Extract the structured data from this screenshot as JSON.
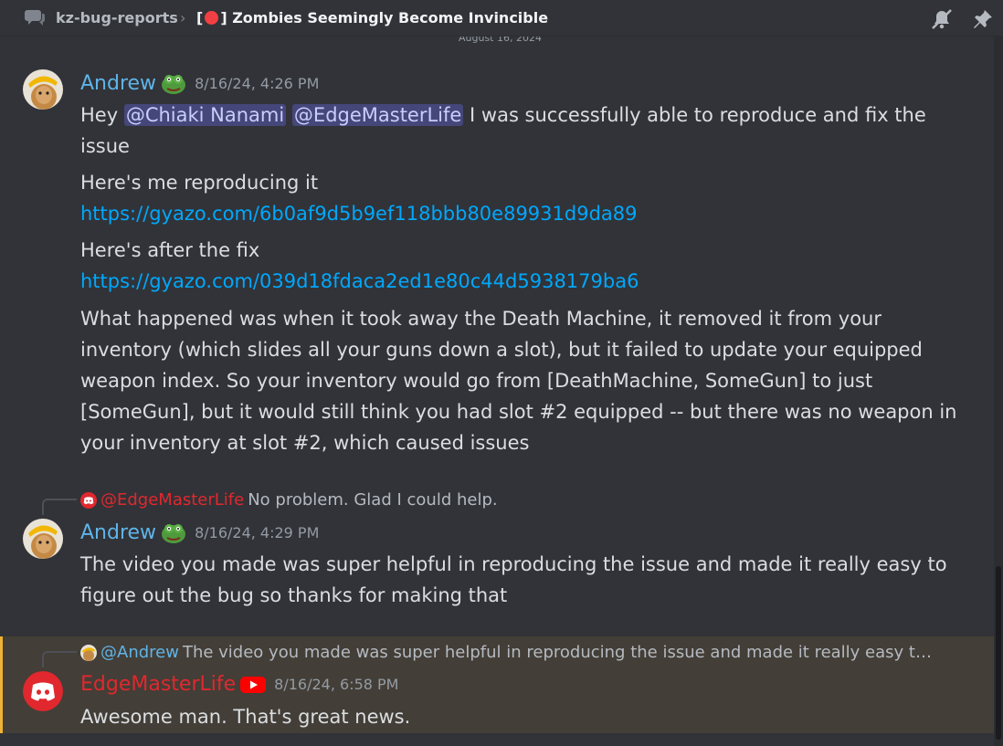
{
  "header": {
    "channel": "kz-bug-reports",
    "separator": "›",
    "thread_prefix": "[",
    "thread_suffix": "] Zombies Seemingly Become Invincible"
  },
  "date_divider": "August 16, 2024",
  "messages": [
    {
      "author": "Andrew",
      "timestamp": "8/16/24, 4:26 PM",
      "greeting": "Hey",
      "mention1": "@Chiaki Nanami",
      "mention2": "@EdgeMasterLife",
      "line1_rest": "I was successfully able to reproduce and fix the issue",
      "line2": "Here's me reproducing it",
      "link1": "https://gyazo.com/6b0af9d5b9ef118bbb80e89931d9da89",
      "line3": "Here's after the fix",
      "link2": "https://gyazo.com/039d18fdaca2ed1e80c44d5938179ba6",
      "line4": "What happened was when it took away the Death Machine, it removed it from your inventory (which slides all your guns down a slot), but it failed to update your equipped weapon index. So your inventory would go from [DeathMachine, SomeGun] to just [SomeGun], but it would still think you had slot #2 equipped -- but there was no weapon in your inventory at slot #2, which caused issues"
    },
    {
      "reply_name": "@EdgeMasterLife",
      "reply_text": "No problem.  Glad I could help.",
      "author": "Andrew",
      "timestamp": "8/16/24, 4:29 PM",
      "text": "The video you made was super helpful in reproducing the issue and made it really easy to figure out the bug so thanks for making that"
    },
    {
      "reply_name": "@Andrew",
      "reply_text": "The video you made was super helpful in reproducing the issue and made it really easy t…",
      "author": "EdgeMasterLife",
      "timestamp": "8/16/24, 6:58 PM",
      "text": "Awesome man.  That's great news."
    }
  ],
  "colors": {
    "background": "#313338",
    "andrew_name": "#5fb4e8",
    "edge_name": "#e0282e",
    "link": "#00a8fc",
    "mention_bg": "#45477a",
    "highlight_bg": "#433e37",
    "highlight_border": "#f0b232"
  },
  "icons": [
    "thread-icon",
    "mute-icon",
    "pin-icon",
    "frog-emoji-icon",
    "youtube-icon",
    "discord-avatar-icon"
  ]
}
